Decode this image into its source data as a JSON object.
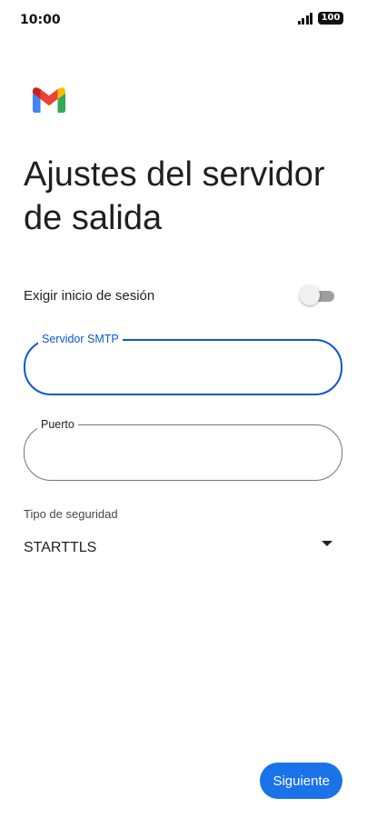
{
  "status_bar": {
    "time": "10:00",
    "battery": "100",
    "signal_icon": "signal-bars-icon"
  },
  "app": {
    "logo_icon": "gmail-logo-icon",
    "title": "Ajustes del servidor de salida"
  },
  "form": {
    "require_signin": {
      "label": "Exigir inicio de sesión",
      "enabled": false
    },
    "smtp_server": {
      "label": "Servidor SMTP",
      "value": "",
      "focused": true
    },
    "port": {
      "label": "Puerto",
      "value": ""
    },
    "security_type": {
      "label": "Tipo de seguridad",
      "value": "STARTTLS",
      "icon": "dropdown-arrow-icon"
    }
  },
  "actions": {
    "next_label": "Siguiente"
  },
  "colors": {
    "accent": "#1a73e8",
    "focus_border": "#0b57d0",
    "text": "#1f1f1f",
    "toggle_off_track": "#9e9e9e"
  }
}
